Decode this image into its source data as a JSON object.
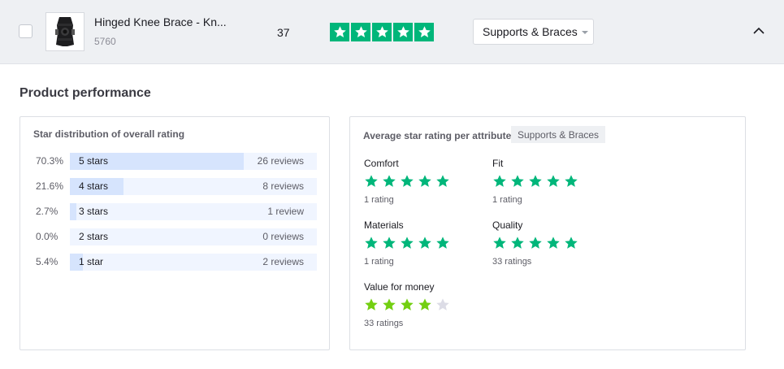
{
  "product": {
    "name": "Hinged Knee Brace - Kn...",
    "sku": "5760",
    "review_count": "37",
    "overall_stars": 5,
    "category": "Supports & Braces"
  },
  "colors": {
    "trustpilot_green": "#00b67a",
    "light_green": "#73cf11",
    "empty_star": "#dcdce6",
    "bar_fill": "#d6e4fd",
    "bar_track": "#f0f5ff"
  },
  "section_title": "Product performance",
  "distribution": {
    "title": "Star distribution of overall rating",
    "rows": [
      {
        "pct": "70.3%",
        "label": "5 stars",
        "reviews": "26 reviews",
        "share": 0.703
      },
      {
        "pct": "21.6%",
        "label": "4 stars",
        "reviews": "8 reviews",
        "share": 0.216
      },
      {
        "pct": "2.7%",
        "label": "3 stars",
        "reviews": "1 review",
        "share": 0.027
      },
      {
        "pct": "0.0%",
        "label": "2 stars",
        "reviews": "0 reviews",
        "share": 0.0
      },
      {
        "pct": "5.4%",
        "label": "1 star",
        "reviews": "2 reviews",
        "share": 0.054
      }
    ]
  },
  "attributes": {
    "title": "Average star rating per attribute",
    "category_tag": "Supports & Braces",
    "items": [
      {
        "name": "Comfort",
        "stars": 5,
        "count": "1 rating",
        "color": "#00b67a"
      },
      {
        "name": "Fit",
        "stars": 5,
        "count": "1 rating",
        "color": "#00b67a"
      },
      {
        "name": "Materials",
        "stars": 5,
        "count": "1 rating",
        "color": "#00b67a"
      },
      {
        "name": "Quality",
        "stars": 5,
        "count": "33 ratings",
        "color": "#00b67a"
      },
      {
        "name": "Value for money",
        "stars": 4,
        "count": "33 ratings",
        "color": "#73cf11"
      }
    ]
  }
}
